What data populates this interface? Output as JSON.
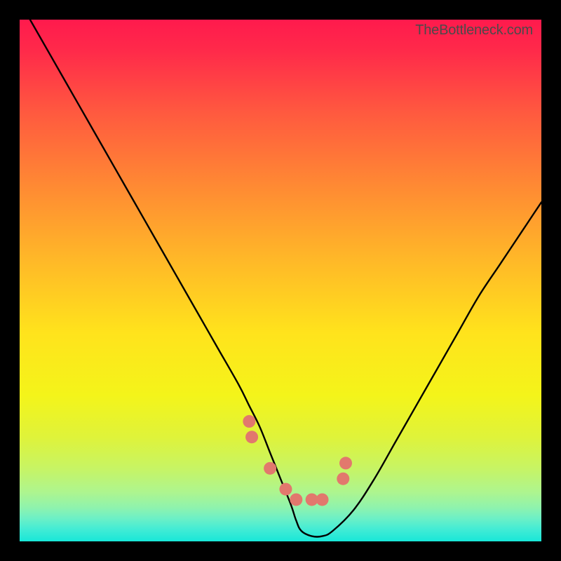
{
  "watermark": "TheBottleneck.com",
  "chart_data": {
    "type": "line",
    "title": "",
    "xlabel": "",
    "ylabel": "",
    "xlim": [
      0,
      100
    ],
    "ylim": [
      0,
      100
    ],
    "series": [
      {
        "name": "bottleneck-curve",
        "x": [
          2,
          6,
          10,
          14,
          18,
          22,
          26,
          30,
          34,
          38,
          42,
          44,
          46,
          48,
          50,
          52,
          53,
          54,
          56,
          58,
          60,
          64,
          68,
          72,
          76,
          80,
          84,
          88,
          92,
          96,
          100
        ],
        "y": [
          100,
          93,
          86,
          79,
          72,
          65,
          58,
          51,
          44,
          37,
          30,
          26,
          22,
          17,
          12,
          7,
          4,
          2,
          1,
          1,
          2,
          6,
          12,
          19,
          26,
          33,
          40,
          47,
          53,
          59,
          65
        ]
      },
      {
        "name": "marker-points",
        "x": [
          44,
          44.5,
          48,
          51,
          53,
          56,
          58,
          62,
          62.5
        ],
        "y": [
          23,
          20,
          14,
          10,
          8,
          8,
          8,
          12,
          15
        ]
      }
    ],
    "gradient_stops": [
      {
        "offset": 0.0,
        "color": "#ff1a4d"
      },
      {
        "offset": 0.06,
        "color": "#ff2a4a"
      },
      {
        "offset": 0.18,
        "color": "#ff5a3f"
      },
      {
        "offset": 0.32,
        "color": "#ff8a33"
      },
      {
        "offset": 0.46,
        "color": "#ffb828"
      },
      {
        "offset": 0.6,
        "color": "#ffe31c"
      },
      {
        "offset": 0.72,
        "color": "#f4f41a"
      },
      {
        "offset": 0.8,
        "color": "#dff33a"
      },
      {
        "offset": 0.86,
        "color": "#c7f464"
      },
      {
        "offset": 0.905,
        "color": "#aef58e"
      },
      {
        "offset": 0.935,
        "color": "#8ff3ad"
      },
      {
        "offset": 0.955,
        "color": "#6ef0c5"
      },
      {
        "offset": 0.975,
        "color": "#46ecd4"
      },
      {
        "offset": 1.0,
        "color": "#18e7d8"
      }
    ],
    "curve_color": "#000000",
    "marker_color": "#e2786d",
    "marker_radius_px": 9
  }
}
